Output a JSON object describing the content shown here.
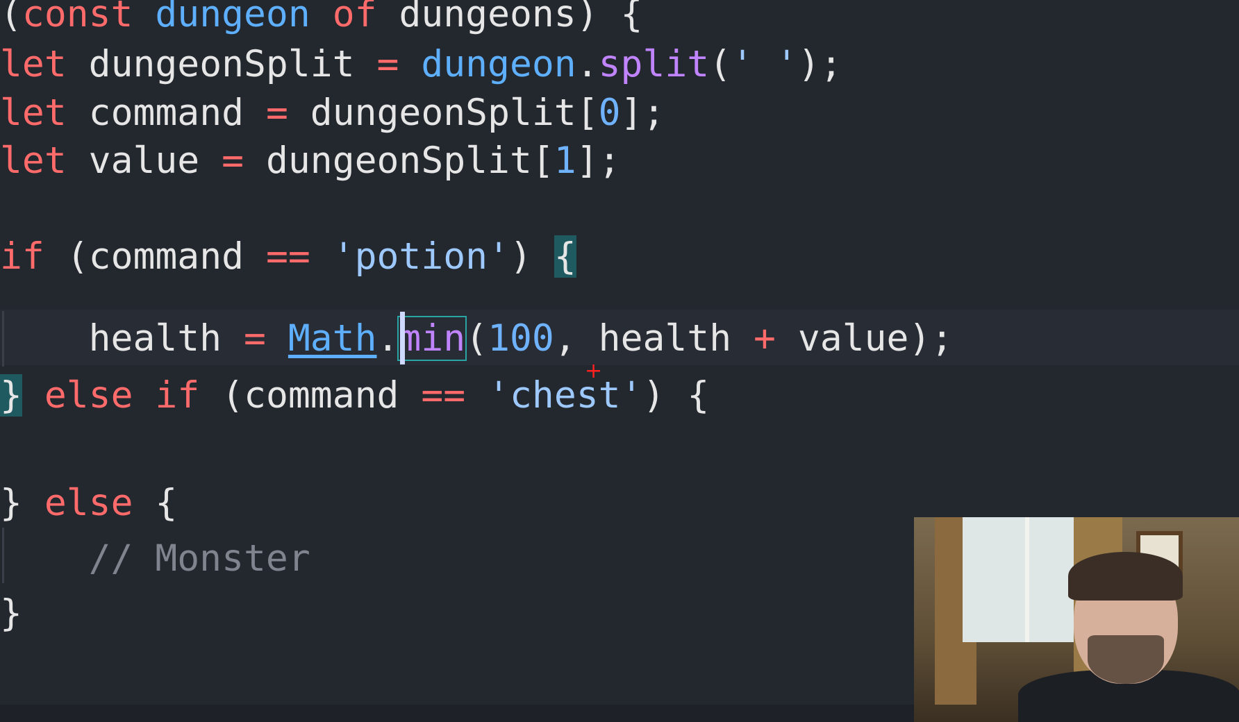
{
  "code": {
    "line1": {
      "open_paren": "(",
      "kw_const": "const",
      "var_dungeon": "dungeon",
      "kw_of": "of",
      "var_dungeons": "dungeons",
      "rest": ") {"
    },
    "line2": {
      "kw": "let",
      "name": "dungeonSplit",
      "eq": "=",
      "obj": "dungeon",
      "dot": ".",
      "method": "split",
      "arg_open": "(",
      "arg_str": "' '",
      "arg_close": ");"
    },
    "line3": {
      "kw": "let",
      "name": "command",
      "eq": "=",
      "src": "dungeonSplit",
      "open": "[",
      "index": "0",
      "close": "];"
    },
    "line4": {
      "kw": "let",
      "name": "value",
      "eq": "=",
      "src": "dungeonSplit",
      "open": "[",
      "index": "1",
      "close": "];"
    },
    "line6": {
      "kw": "if",
      "cond_open": "(command",
      "eq": "==",
      "str": "'potion'",
      "cond_close": ")",
      "brace": "{"
    },
    "line7": {
      "lhs": "health",
      "eq": "=",
      "obj": "Math",
      "dot": ".",
      "method": "min",
      "open": "(",
      "num": "100",
      "comma": ",",
      "arg2": "health",
      "plus": "+",
      "arg3": "value",
      "close": ");"
    },
    "line8": {
      "brace": "}",
      "kw_else": "else",
      "kw_if": "if",
      "cond_open": "(command",
      "eq": "==",
      "str": "'chest'",
      "cond_close": ")",
      "brace_open": "{"
    },
    "line10": {
      "brace": "}",
      "kw_else": "else",
      "brace_open": "{"
    },
    "line11": {
      "comment": "// Monster"
    },
    "line12": {
      "brace": "}"
    }
  },
  "colors": {
    "background": "#23272e",
    "keyword": "#ff6b6b",
    "variable": "#5eb0ff",
    "function": "#c184ff",
    "string": "#9ec9ff",
    "comment": "#7f848e",
    "bracket_highlight": "#1f5a60"
  }
}
